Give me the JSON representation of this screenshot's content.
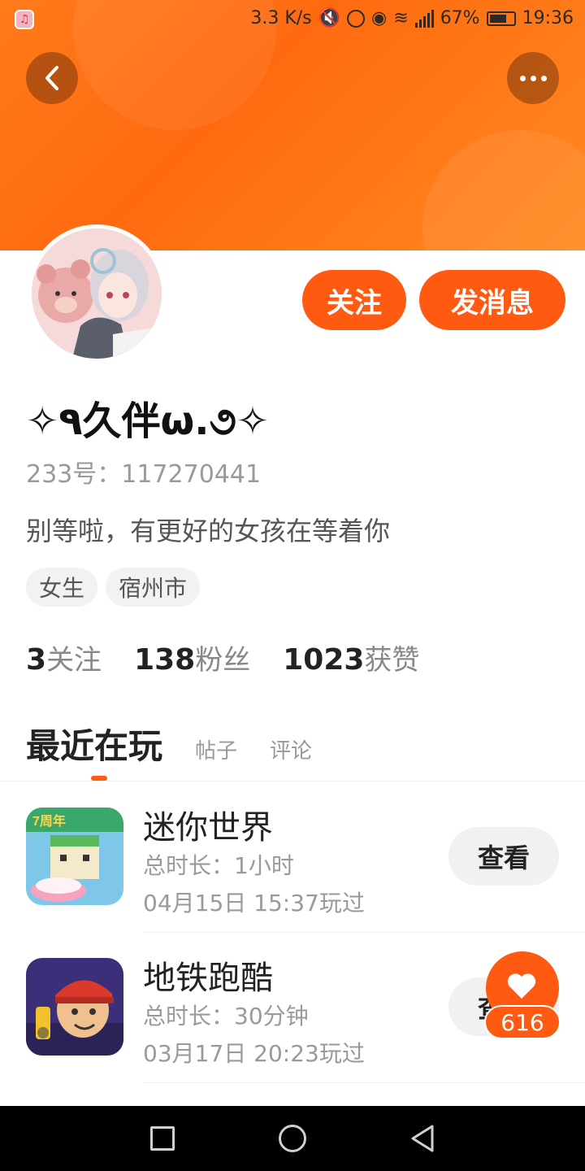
{
  "status_bar": {
    "net_speed": "3.3 K/s",
    "battery": "67%",
    "time": "19:36",
    "icons": [
      "mute-icon",
      "alarm-icon",
      "eye-icon",
      "wifi-icon",
      "signal-icon",
      "battery-icon"
    ]
  },
  "header": {
    "back_icon": "chevron-left-icon",
    "more_icon": "more-dots-icon",
    "accent": "#ff6a10"
  },
  "actions": {
    "follow_label": "关注",
    "message_label": "发消息"
  },
  "profile": {
    "username": "✧٩久伴ω.૭✧",
    "uid": "233号：117270441",
    "bio": "别等啦，有更好的女孩在等着你",
    "tags": [
      "女生",
      "宿州市"
    ],
    "stats": [
      {
        "num": "3",
        "label": "关注"
      },
      {
        "num": "138",
        "label": "粉丝"
      },
      {
        "num": "1023",
        "label": "获赞"
      }
    ]
  },
  "tabs": {
    "active": "最近在玩",
    "items": [
      "帖子",
      "评论"
    ]
  },
  "games": [
    {
      "name": "迷你世界",
      "duration": "总时长：1小时",
      "last_played": "04月15日 15:37玩过",
      "view_label": "查看"
    },
    {
      "name": "地铁跑酷",
      "duration": "总时长：30分钟",
      "last_played": "03月17日 20:23玩过",
      "view_label": "查看"
    }
  ],
  "like": {
    "count": "616",
    "icon": "heart-icon"
  },
  "navbar": {
    "icons": [
      "recent-apps-icon",
      "home-icon",
      "nav-back-icon"
    ]
  }
}
